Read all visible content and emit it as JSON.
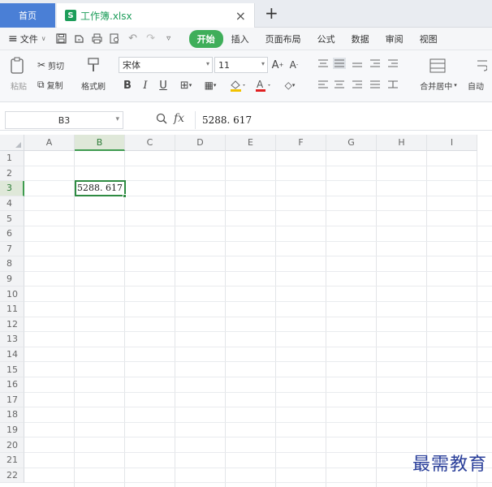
{
  "tabs": {
    "home_label": "首页",
    "file_icon": "S",
    "file_name": "工作簿.xlsx",
    "close_glyph": "×",
    "add_glyph": "+"
  },
  "menu": {
    "file_label": "文件",
    "items": [
      "开始",
      "插入",
      "页面布局",
      "公式",
      "数据",
      "审阅",
      "视图"
    ],
    "active_index": 0
  },
  "ribbon": {
    "paste_label": "粘贴",
    "cut_label": "剪切",
    "copy_label": "复制",
    "format_painter_label": "格式刷",
    "font_name": "宋体",
    "font_size": "11",
    "merge_label": "合并居中",
    "autowrap_label": "自动"
  },
  "formula_bar": {
    "cell_ref": "B3",
    "fx_label": "fx",
    "value": "5288. 617"
  },
  "sheet": {
    "columns": [
      "A",
      "B",
      "C",
      "D",
      "E",
      "F",
      "G",
      "H",
      "I"
    ],
    "rows": [
      "1",
      "2",
      "3",
      "4",
      "5",
      "6",
      "7",
      "8",
      "9",
      "10",
      "11",
      "12",
      "13",
      "14",
      "15",
      "16",
      "17",
      "18",
      "19",
      "20",
      "21",
      "22"
    ],
    "active_col": "B",
    "active_row": "3",
    "active_value": "5288. 617"
  },
  "colors": {
    "accent_green": "#3fae5a",
    "home_tab_blue": "#4a7fd6",
    "selection_green": "#2e8b42"
  },
  "watermark": "最需教育"
}
